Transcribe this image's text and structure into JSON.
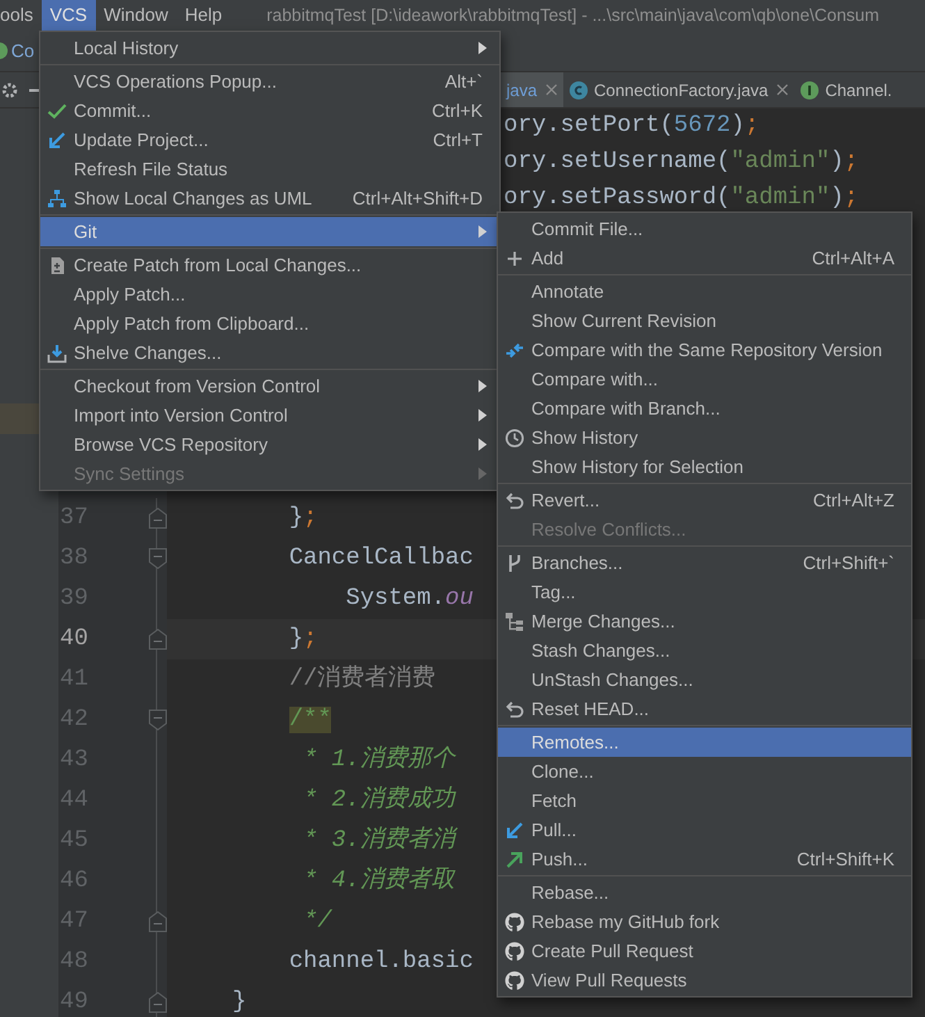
{
  "menubar": [
    {
      "label": "ools",
      "selected": false
    },
    {
      "label": "VCS",
      "selected": true
    },
    {
      "label": "Window",
      "selected": false
    },
    {
      "label": "Help",
      "selected": false
    }
  ],
  "window": {
    "title": "rabbitmqTest [D:\\ideawork\\rabbitmqTest] - ...\\src\\main\\java\\com\\qb\\one\\Consum"
  },
  "navbar": {
    "crumb": "Co"
  },
  "tabs": [
    {
      "label": "java",
      "selected": true,
      "closable": true
    },
    {
      "label": "ConnectionFactory.java",
      "kind": "class",
      "selected": false,
      "closable": true
    },
    {
      "label": "Channel.",
      "kind": "interface",
      "selected": false,
      "closable": false
    }
  ],
  "editor": {
    "fragments": [
      [
        {
          "text": "ory.setPort(",
          "kind": "plain"
        },
        {
          "text": "5672",
          "kind": "number"
        },
        {
          "text": ")",
          "kind": "plain"
        },
        {
          "text": ";",
          "kind": "punct"
        }
      ],
      [
        {
          "text": "ory.setUsername(",
          "kind": "plain"
        },
        {
          "text": "\"admin\"",
          "kind": "string"
        },
        {
          "text": ")",
          "kind": "plain"
        },
        {
          "text": ";",
          "kind": "punct"
        }
      ],
      [
        {
          "text": "ory.setPassword(",
          "kind": "plain"
        },
        {
          "text": "\"admin\"",
          "kind": "string"
        },
        {
          "text": ")",
          "kind": "plain"
        },
        {
          "text": ";",
          "kind": "punct"
        }
      ]
    ],
    "lines": [
      {
        "number": "37",
        "current": false,
        "kind": "fold_end",
        "segments": [
          {
            "text": "    }",
            "kind": "plain"
          },
          {
            "text": ";",
            "kind": "punct"
          }
        ]
      },
      {
        "number": "38",
        "current": false,
        "kind": "fold_start",
        "segments": [
          {
            "text": "    CancelCallbac",
            "kind": "plain"
          }
        ]
      },
      {
        "number": "39",
        "current": false,
        "kind": "plain",
        "segments": [
          {
            "text": "        System.",
            "kind": "plain"
          },
          {
            "text": "ou",
            "kind": "field"
          }
        ]
      },
      {
        "number": "40",
        "current": true,
        "kind": "fold_end",
        "segments": [
          {
            "text": "    }",
            "kind": "plain"
          },
          {
            "text": ";",
            "kind": "punct"
          }
        ]
      },
      {
        "number": "41",
        "current": false,
        "kind": "plain",
        "segments": [
          {
            "text": "    //消费者消费",
            "kind": "comment"
          }
        ]
      },
      {
        "number": "42",
        "current": false,
        "kind": "fold_start",
        "segments": [
          {
            "text": "    /**",
            "kind": "doc_match"
          }
        ]
      },
      {
        "number": "43",
        "current": false,
        "kind": "plain",
        "segments": [
          {
            "text": "     * 1.消费那个",
            "kind": "doc"
          }
        ]
      },
      {
        "number": "44",
        "current": false,
        "kind": "plain",
        "segments": [
          {
            "text": "     * 2.消费成功",
            "kind": "doc"
          }
        ]
      },
      {
        "number": "45",
        "current": false,
        "kind": "plain",
        "segments": [
          {
            "text": "     * 3.消费者消",
            "kind": "doc"
          }
        ]
      },
      {
        "number": "46",
        "current": false,
        "kind": "plain",
        "segments": [
          {
            "text": "     * 4.消费者取",
            "kind": "doc"
          }
        ]
      },
      {
        "number": "47",
        "current": false,
        "kind": "fold_end",
        "segments": [
          {
            "text": "     */",
            "kind": "doc"
          }
        ]
      },
      {
        "number": "48",
        "current": false,
        "kind": "plain",
        "segments": [
          {
            "text": "    channel.basic",
            "kind": "plain"
          }
        ]
      },
      {
        "number": "49",
        "current": false,
        "kind": "fold_end",
        "segments": [
          {
            "text": "}",
            "kind": "plain"
          }
        ]
      }
    ]
  },
  "vcs_menu": {
    "sections": [
      [
        {
          "label": "Local History",
          "submenu": true,
          "selected": false,
          "disabled": false
        }
      ],
      [
        {
          "label": "VCS Operations Popup...",
          "shortcut": "Alt+`",
          "submenu": false,
          "selected": false,
          "disabled": false
        },
        {
          "label": "Commit...",
          "shortcut": "Ctrl+K",
          "kind": "check",
          "submenu": false,
          "selected": false,
          "disabled": false
        },
        {
          "label": "Update Project...",
          "shortcut": "Ctrl+T",
          "kind": "arrow_in",
          "submenu": false,
          "selected": false,
          "disabled": false
        },
        {
          "label": "Refresh File Status",
          "submenu": false,
          "selected": false,
          "disabled": false
        },
        {
          "label": "Show Local Changes as UML",
          "shortcut": "Ctrl+Alt+Shift+D",
          "kind": "diagram",
          "submenu": false,
          "selected": false,
          "disabled": false
        }
      ],
      [
        {
          "label": "Git",
          "submenu": true,
          "selected": true,
          "disabled": false
        }
      ],
      [
        {
          "label": "Create Patch from Local Changes...",
          "kind": "patch",
          "submenu": false,
          "selected": false,
          "disabled": false
        },
        {
          "label": "Apply Patch...",
          "submenu": false,
          "selected": false,
          "disabled": false
        },
        {
          "label": "Apply Patch from Clipboard...",
          "submenu": false,
          "selected": false,
          "disabled": false
        },
        {
          "label": "Shelve Changes...",
          "kind": "shelve",
          "submenu": false,
          "selected": false,
          "disabled": false
        }
      ],
      [
        {
          "label": "Checkout from Version Control",
          "submenu": true,
          "selected": false,
          "disabled": false
        },
        {
          "label": "Import into Version Control",
          "submenu": true,
          "selected": false,
          "disabled": false
        },
        {
          "label": "Browse VCS Repository",
          "submenu": true,
          "selected": false,
          "disabled": false
        },
        {
          "label": "Sync Settings",
          "submenu": true,
          "selected": false,
          "disabled": true
        }
      ]
    ]
  },
  "git_menu": {
    "sections": [
      [
        {
          "label": "Commit File...",
          "submenu": false,
          "selected": false,
          "disabled": false
        },
        {
          "label": "Add",
          "shortcut": "Ctrl+Alt+A",
          "kind": "plus",
          "submenu": false,
          "selected": false,
          "disabled": false
        }
      ],
      [
        {
          "label": "Annotate",
          "submenu": false,
          "selected": false,
          "disabled": false
        },
        {
          "label": "Show Current Revision",
          "submenu": false,
          "selected": false,
          "disabled": false
        },
        {
          "label": "Compare with the Same Repository Version",
          "kind": "compare",
          "submenu": false,
          "selected": false,
          "disabled": false
        },
        {
          "label": "Compare with...",
          "submenu": false,
          "selected": false,
          "disabled": false
        },
        {
          "label": "Compare with Branch...",
          "submenu": false,
          "selected": false,
          "disabled": false
        },
        {
          "label": "Show History",
          "kind": "clock",
          "submenu": false,
          "selected": false,
          "disabled": false
        },
        {
          "label": "Show History for Selection",
          "submenu": false,
          "selected": false,
          "disabled": false
        }
      ],
      [
        {
          "label": "Revert...",
          "shortcut": "Ctrl+Alt+Z",
          "kind": "undo",
          "submenu": false,
          "selected": false,
          "disabled": false
        },
        {
          "label": "Resolve Conflicts...",
          "submenu": false,
          "selected": false,
          "disabled": true
        }
      ],
      [
        {
          "label": "Branches...",
          "shortcut": "Ctrl+Shift+`",
          "kind": "branch",
          "submenu": false,
          "selected": false,
          "disabled": false
        },
        {
          "label": "Tag...",
          "submenu": false,
          "selected": false,
          "disabled": false
        },
        {
          "label": "Merge Changes...",
          "kind": "merge",
          "submenu": false,
          "selected": false,
          "disabled": false
        },
        {
          "label": "Stash Changes...",
          "submenu": false,
          "selected": false,
          "disabled": false
        },
        {
          "label": "UnStash Changes...",
          "submenu": false,
          "selected": false,
          "disabled": false
        },
        {
          "label": "Reset HEAD...",
          "kind": "undo",
          "submenu": false,
          "selected": false,
          "disabled": false
        }
      ],
      [
        {
          "label": "Remotes...",
          "submenu": false,
          "selected": true,
          "disabled": false
        },
        {
          "label": "Clone...",
          "submenu": false,
          "selected": false,
          "disabled": false
        },
        {
          "label": "Fetch",
          "submenu": false,
          "selected": false,
          "disabled": false
        },
        {
          "label": "Pull...",
          "kind": "arrow_in",
          "submenu": false,
          "selected": false,
          "disabled": false
        },
        {
          "label": "Push...",
          "shortcut": "Ctrl+Shift+K",
          "kind": "arrow_out",
          "submenu": false,
          "selected": false,
          "disabled": false
        }
      ],
      [
        {
          "label": "Rebase...",
          "submenu": false,
          "selected": false,
          "disabled": false
        },
        {
          "label": "Rebase my GitHub fork",
          "kind": "github",
          "submenu": false,
          "selected": false,
          "disabled": false
        },
        {
          "label": "Create Pull Request",
          "kind": "github",
          "submenu": false,
          "selected": false,
          "disabled": false
        },
        {
          "label": "View Pull Requests",
          "kind": "github",
          "submenu": false,
          "selected": false,
          "disabled": false
        }
      ]
    ]
  }
}
